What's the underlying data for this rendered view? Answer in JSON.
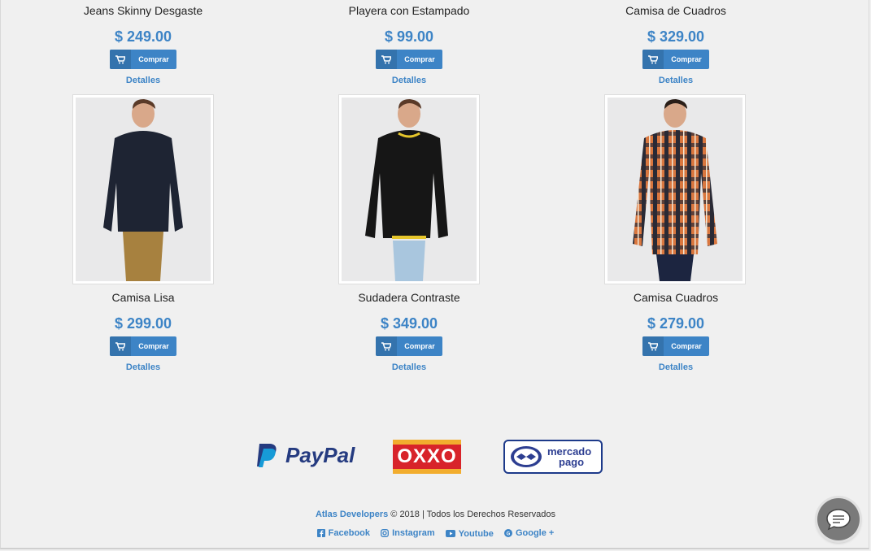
{
  "top_row": [
    {
      "name": "Jeans Skinny Desgaste",
      "price": "$ 249.00",
      "buy": "Comprar",
      "details": "Detalles"
    },
    {
      "name": "Playera con Estampado",
      "price": "$ 99.00",
      "buy": "Comprar",
      "details": "Detalles"
    },
    {
      "name": "Camisa de Cuadros",
      "price": "$ 329.00",
      "buy": "Comprar",
      "details": "Detalles"
    }
  ],
  "bottom_row": [
    {
      "name": "Camisa Lisa",
      "price": "$ 299.00",
      "buy": "Comprar",
      "details": "Detalles"
    },
    {
      "name": "Sudadera Contraste",
      "price": "$ 349.00",
      "buy": "Comprar",
      "details": "Detalles"
    },
    {
      "name": "Camisa Cuadros",
      "price": "$ 279.00",
      "buy": "Comprar",
      "details": "Detalles"
    }
  ],
  "payment_logos": {
    "paypal": "PayPal",
    "oxxo": "OXXO",
    "mercado_1": "mercado",
    "mercado_2": "pago"
  },
  "footer": {
    "brand": "Atlas Developers",
    "text": "© 2018 | Todos los Derechos Reservados"
  },
  "social": [
    {
      "label": "Facebook",
      "icon": "facebook-icon"
    },
    {
      "label": "Instagram",
      "icon": "instagram-icon"
    },
    {
      "label": "Youtube",
      "icon": "youtube-icon"
    },
    {
      "label": "Google +",
      "icon": "google-plus-icon"
    }
  ],
  "colors": {
    "accent": "#3d84c6",
    "background": "#f0f0f0"
  }
}
